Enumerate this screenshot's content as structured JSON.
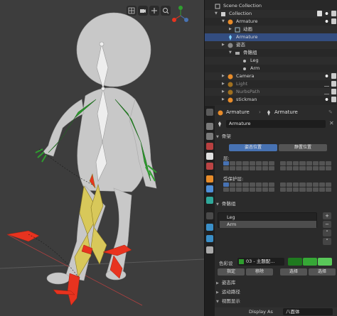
{
  "outliner": {
    "rows": [
      {
        "label": "Scene Collection"
      },
      {
        "label": "Collection"
      },
      {
        "label": "Armature"
      },
      {
        "label": "动画"
      },
      {
        "label": "Armature"
      },
      {
        "label": "姿态"
      },
      {
        "label": "骨骼组"
      },
      {
        "label": "Leg"
      },
      {
        "label": "Arm"
      },
      {
        "label": "Camera"
      },
      {
        "label": "Light"
      },
      {
        "label": "NurbsPath"
      },
      {
        "label": "stickman"
      }
    ]
  },
  "properties": {
    "object_name": "Armature",
    "data_name": "Armature",
    "datablock_field": "Armature",
    "skeleton_panel": "骨架",
    "pose_position_button": "姿态位置",
    "rest_position_button": "静置位置",
    "layers_label": "层:",
    "protected_layers_label": "受保护层:",
    "bone_groups_panel": "骨骼组",
    "bone_groups": [
      "Leg",
      "Arm"
    ],
    "color_set_label": "色彩设",
    "color_set_value": "03 - 主题配...",
    "assign_button": "指定",
    "remove_button": "移除",
    "select_button": "选择",
    "deselect_button": "选择",
    "pose_library_panel": "姿态库",
    "motion_paths_panel": "运动路径",
    "viewport_display_panel": "视图显示",
    "display_as_label": "Display As",
    "display_as_value": "八面体"
  },
  "colors": {
    "accent_blue": "#4772b3",
    "selection_row": "#334d80",
    "bone_green": "#2f9e2f",
    "bone_red": "#e8331f",
    "bone_yellow": "#d8c85a"
  }
}
